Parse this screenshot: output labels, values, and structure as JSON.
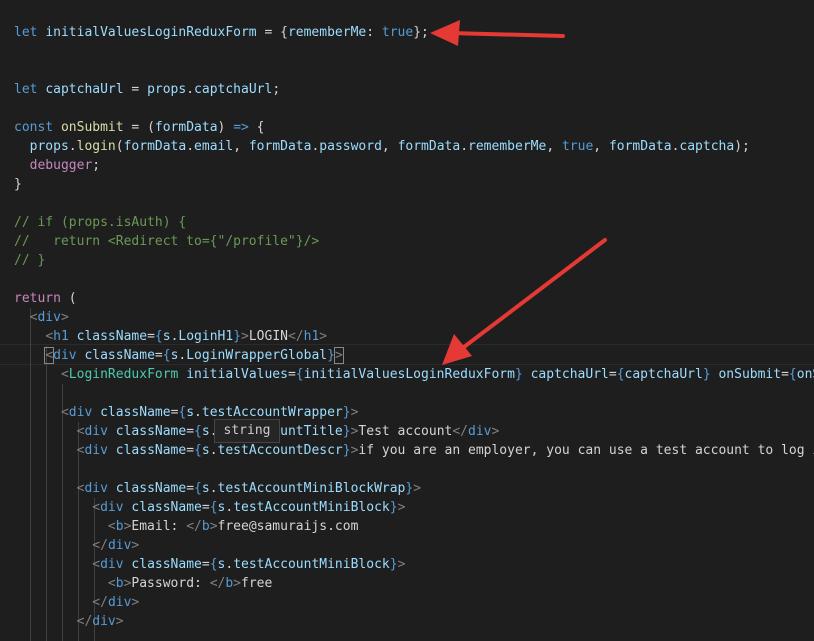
{
  "code_lines": [
    [
      {
        "t": "let ",
        "c": "kw"
      },
      {
        "t": "initialValuesLoginReduxForm",
        "c": "var"
      },
      {
        "t": " = {",
        "c": "p"
      },
      {
        "t": "rememberMe",
        "c": "var"
      },
      {
        "t": ": ",
        "c": "p"
      },
      {
        "t": "true",
        "c": "kw"
      },
      {
        "t": "};",
        "c": "p"
      }
    ],
    [],
    [],
    [
      {
        "t": "let ",
        "c": "kw"
      },
      {
        "t": "captchaUrl",
        "c": "var"
      },
      {
        "t": " = ",
        "c": "p"
      },
      {
        "t": "props",
        "c": "var"
      },
      {
        "t": ".",
        "c": "p"
      },
      {
        "t": "captchaUrl",
        "c": "var"
      },
      {
        "t": ";",
        "c": "p"
      }
    ],
    [],
    [
      {
        "t": "const ",
        "c": "kw"
      },
      {
        "t": "onSubmit",
        "c": "fn"
      },
      {
        "t": " = (",
        "c": "p"
      },
      {
        "t": "formData",
        "c": "var"
      },
      {
        "t": ") ",
        "c": "p"
      },
      {
        "t": "=>",
        "c": "kw"
      },
      {
        "t": " {",
        "c": "p"
      }
    ],
    [
      {
        "t": "  ",
        "c": "p"
      },
      {
        "t": "props",
        "c": "var"
      },
      {
        "t": ".",
        "c": "p"
      },
      {
        "t": "login",
        "c": "fn"
      },
      {
        "t": "(",
        "c": "p"
      },
      {
        "t": "formData",
        "c": "var"
      },
      {
        "t": ".",
        "c": "p"
      },
      {
        "t": "email",
        "c": "var"
      },
      {
        "t": ", ",
        "c": "p"
      },
      {
        "t": "formData",
        "c": "var"
      },
      {
        "t": ".",
        "c": "p"
      },
      {
        "t": "password",
        "c": "var"
      },
      {
        "t": ", ",
        "c": "p"
      },
      {
        "t": "formData",
        "c": "var"
      },
      {
        "t": ".",
        "c": "p"
      },
      {
        "t": "rememberMe",
        "c": "var"
      },
      {
        "t": ", ",
        "c": "p"
      },
      {
        "t": "true",
        "c": "kw"
      },
      {
        "t": ", ",
        "c": "p"
      },
      {
        "t": "formData",
        "c": "var"
      },
      {
        "t": ".",
        "c": "p"
      },
      {
        "t": "captcha",
        "c": "var"
      },
      {
        "t": ");",
        "c": "p"
      }
    ],
    [
      {
        "t": "  ",
        "c": "p"
      },
      {
        "t": "debugger",
        "c": "ctl"
      },
      {
        "t": ";",
        "c": "p"
      }
    ],
    [
      {
        "t": "}",
        "c": "p"
      }
    ],
    [],
    [
      {
        "t": "// if (props.isAuth) {",
        "c": "cm"
      }
    ],
    [
      {
        "t": "//   return <Redirect to={\"/profile\"}/>",
        "c": "cm"
      }
    ],
    [
      {
        "t": "// }",
        "c": "cm"
      }
    ],
    [],
    [
      {
        "t": "return",
        "c": "ctl"
      },
      {
        "t": " (",
        "c": "p"
      }
    ],
    [
      {
        "t": "  ",
        "c": "p"
      },
      {
        "t": "<",
        "c": "tg"
      },
      {
        "t": "div",
        "c": "tg"
      },
      {
        "t": ">",
        "c": "tg"
      }
    ],
    [
      {
        "t": "    ",
        "c": "p"
      },
      {
        "t": "<",
        "c": "tg"
      },
      {
        "t": "h1",
        "c": "tg"
      },
      {
        "t": " ",
        "c": "p"
      },
      {
        "t": "className",
        "c": "at"
      },
      {
        "t": "=",
        "c": "p"
      },
      {
        "t": "{",
        "c": "br"
      },
      {
        "t": "s",
        "c": "var"
      },
      {
        "t": ".",
        "c": "p"
      },
      {
        "t": "LoginH1",
        "c": "var"
      },
      {
        "t": "}",
        "c": "br"
      },
      {
        "t": ">",
        "c": "tg"
      },
      {
        "t": "LOGIN",
        "c": "p"
      },
      {
        "t": "</",
        "c": "tg"
      },
      {
        "t": "h1",
        "c": "tg"
      },
      {
        "t": ">",
        "c": "tg"
      }
    ],
    [
      {
        "t": "    ",
        "c": "p"
      },
      {
        "t": "<",
        "c": "tg",
        "box": true
      },
      {
        "t": "div",
        "c": "tg"
      },
      {
        "t": " ",
        "c": "p"
      },
      {
        "t": "className",
        "c": "at"
      },
      {
        "t": "=",
        "c": "p"
      },
      {
        "t": "{",
        "c": "br"
      },
      {
        "t": "s",
        "c": "var"
      },
      {
        "t": ".",
        "c": "p"
      },
      {
        "t": "LoginWrapperGlobal",
        "c": "var"
      },
      {
        "t": "}",
        "c": "br"
      },
      {
        "t": ">",
        "c": "tg",
        "box": true
      }
    ],
    [
      {
        "t": "      ",
        "c": "p"
      },
      {
        "t": "<",
        "c": "tg"
      },
      {
        "t": "LoginReduxForm",
        "c": "cmp"
      },
      {
        "t": " ",
        "c": "p"
      },
      {
        "t": "initialValues",
        "c": "at"
      },
      {
        "t": "=",
        "c": "p"
      },
      {
        "t": "{",
        "c": "br"
      },
      {
        "t": "initialValuesLoginReduxForm",
        "c": "var"
      },
      {
        "t": "}",
        "c": "br"
      },
      {
        "t": " ",
        "c": "p"
      },
      {
        "t": "captchaUrl",
        "c": "at"
      },
      {
        "t": "=",
        "c": "p"
      },
      {
        "t": "{",
        "c": "br"
      },
      {
        "t": "captchaUrl",
        "c": "var"
      },
      {
        "t": "}",
        "c": "br"
      },
      {
        "t": " ",
        "c": "p"
      },
      {
        "t": "onSubmit",
        "c": "at"
      },
      {
        "t": "=",
        "c": "p"
      },
      {
        "t": "{",
        "c": "br"
      },
      {
        "t": "onSu",
        "c": "var"
      }
    ],
    [],
    [
      {
        "t": "      ",
        "c": "p"
      },
      {
        "t": "<",
        "c": "tg"
      },
      {
        "t": "div",
        "c": "tg"
      },
      {
        "t": " ",
        "c": "p"
      },
      {
        "t": "className",
        "c": "at"
      },
      {
        "t": "=",
        "c": "p"
      },
      {
        "t": "{",
        "c": "br"
      },
      {
        "t": "s",
        "c": "var"
      },
      {
        "t": ".",
        "c": "p"
      },
      {
        "t": "testAccountWrapper",
        "c": "var"
      },
      {
        "t": "}",
        "c": "br"
      },
      {
        "t": ">",
        "c": "tg"
      }
    ],
    [
      {
        "t": "        ",
        "c": "p"
      },
      {
        "t": "<",
        "c": "tg"
      },
      {
        "t": "div",
        "c": "tg"
      },
      {
        "t": " ",
        "c": "p"
      },
      {
        "t": "className",
        "c": "at"
      },
      {
        "t": "=",
        "c": "p"
      },
      {
        "t": "{",
        "c": "br"
      },
      {
        "t": "s",
        "c": "var"
      },
      {
        "t": ".",
        "c": "p"
      },
      {
        "t": "testAccountTitle",
        "c": "var"
      },
      {
        "t": "}",
        "c": "br"
      },
      {
        "t": ">",
        "c": "tg"
      },
      {
        "t": "Test account",
        "c": "p"
      },
      {
        "t": "</",
        "c": "tg"
      },
      {
        "t": "div",
        "c": "tg"
      },
      {
        "t": ">",
        "c": "tg"
      }
    ],
    [
      {
        "t": "        ",
        "c": "p"
      },
      {
        "t": "<",
        "c": "tg"
      },
      {
        "t": "div",
        "c": "tg"
      },
      {
        "t": " ",
        "c": "p"
      },
      {
        "t": "className",
        "c": "at"
      },
      {
        "t": "=",
        "c": "p"
      },
      {
        "t": "{",
        "c": "br"
      },
      {
        "t": "s",
        "c": "var"
      },
      {
        "t": ".",
        "c": "p"
      },
      {
        "t": "testAccountDescr",
        "c": "var"
      },
      {
        "t": "}",
        "c": "br"
      },
      {
        "t": ">",
        "c": "tg"
      },
      {
        "t": "if you are an employer, you can use a test account to log in",
        "c": "p"
      }
    ],
    [],
    [
      {
        "t": "        ",
        "c": "p"
      },
      {
        "t": "<",
        "c": "tg"
      },
      {
        "t": "div",
        "c": "tg"
      },
      {
        "t": " ",
        "c": "p"
      },
      {
        "t": "className",
        "c": "at"
      },
      {
        "t": "=",
        "c": "p"
      },
      {
        "t": "{",
        "c": "br"
      },
      {
        "t": "s",
        "c": "var"
      },
      {
        "t": ".",
        "c": "p"
      },
      {
        "t": "testAccountMiniBlockWrap",
        "c": "var"
      },
      {
        "t": "}",
        "c": "br"
      },
      {
        "t": ">",
        "c": "tg"
      }
    ],
    [
      {
        "t": "          ",
        "c": "p"
      },
      {
        "t": "<",
        "c": "tg"
      },
      {
        "t": "div",
        "c": "tg"
      },
      {
        "t": " ",
        "c": "p"
      },
      {
        "t": "className",
        "c": "at"
      },
      {
        "t": "=",
        "c": "p"
      },
      {
        "t": "{",
        "c": "br"
      },
      {
        "t": "s",
        "c": "var"
      },
      {
        "t": ".",
        "c": "p"
      },
      {
        "t": "testAccountMiniBlock",
        "c": "var"
      },
      {
        "t": "}",
        "c": "br"
      },
      {
        "t": ">",
        "c": "tg"
      }
    ],
    [
      {
        "t": "            ",
        "c": "p"
      },
      {
        "t": "<",
        "c": "tg"
      },
      {
        "t": "b",
        "c": "tg"
      },
      {
        "t": ">",
        "c": "tg"
      },
      {
        "t": "Email: ",
        "c": "p"
      },
      {
        "t": "</",
        "c": "tg"
      },
      {
        "t": "b",
        "c": "tg"
      },
      {
        "t": ">",
        "c": "tg"
      },
      {
        "t": "free@samuraijs.com",
        "c": "p"
      }
    ],
    [
      {
        "t": "          ",
        "c": "p"
      },
      {
        "t": "</",
        "c": "tg"
      },
      {
        "t": "div",
        "c": "tg"
      },
      {
        "t": ">",
        "c": "tg"
      }
    ],
    [
      {
        "t": "          ",
        "c": "p"
      },
      {
        "t": "<",
        "c": "tg"
      },
      {
        "t": "div",
        "c": "tg"
      },
      {
        "t": " ",
        "c": "p"
      },
      {
        "t": "className",
        "c": "at"
      },
      {
        "t": "=",
        "c": "p"
      },
      {
        "t": "{",
        "c": "br"
      },
      {
        "t": "s",
        "c": "var"
      },
      {
        "t": ".",
        "c": "p"
      },
      {
        "t": "testAccountMiniBlock",
        "c": "var"
      },
      {
        "t": "}",
        "c": "br"
      },
      {
        "t": ">",
        "c": "tg"
      }
    ],
    [
      {
        "t": "            ",
        "c": "p"
      },
      {
        "t": "<",
        "c": "tg"
      },
      {
        "t": "b",
        "c": "tg"
      },
      {
        "t": ">",
        "c": "tg"
      },
      {
        "t": "Password: ",
        "c": "p"
      },
      {
        "t": "</",
        "c": "tg"
      },
      {
        "t": "b",
        "c": "tg"
      },
      {
        "t": ">",
        "c": "tg"
      },
      {
        "t": "free",
        "c": "p"
      }
    ],
    [
      {
        "t": "          ",
        "c": "p"
      },
      {
        "t": "</",
        "c": "tg"
      },
      {
        "t": "div",
        "c": "tg"
      },
      {
        "t": ">",
        "c": "tg"
      }
    ],
    [
      {
        "t": "        ",
        "c": "p"
      },
      {
        "t": "</",
        "c": "tg"
      },
      {
        "t": "div",
        "c": "tg"
      },
      {
        "t": ">",
        "c": "tg"
      }
    ]
  ],
  "hover_tooltip": {
    "text": "string"
  },
  "colors": {
    "background": "#1e1e1e",
    "keyword": "#569cd6",
    "variable": "#9cdcfe",
    "function": "#dcdcaa",
    "control": "#c586c0",
    "comment": "#6a9955",
    "tag": "#808080",
    "tag_name": "#569cd6",
    "component": "#4ec9b0",
    "attribute": "#9cdcfe",
    "brace": "#569cd6",
    "punctuation": "#d4d4d4",
    "arrow": "#e53935"
  }
}
